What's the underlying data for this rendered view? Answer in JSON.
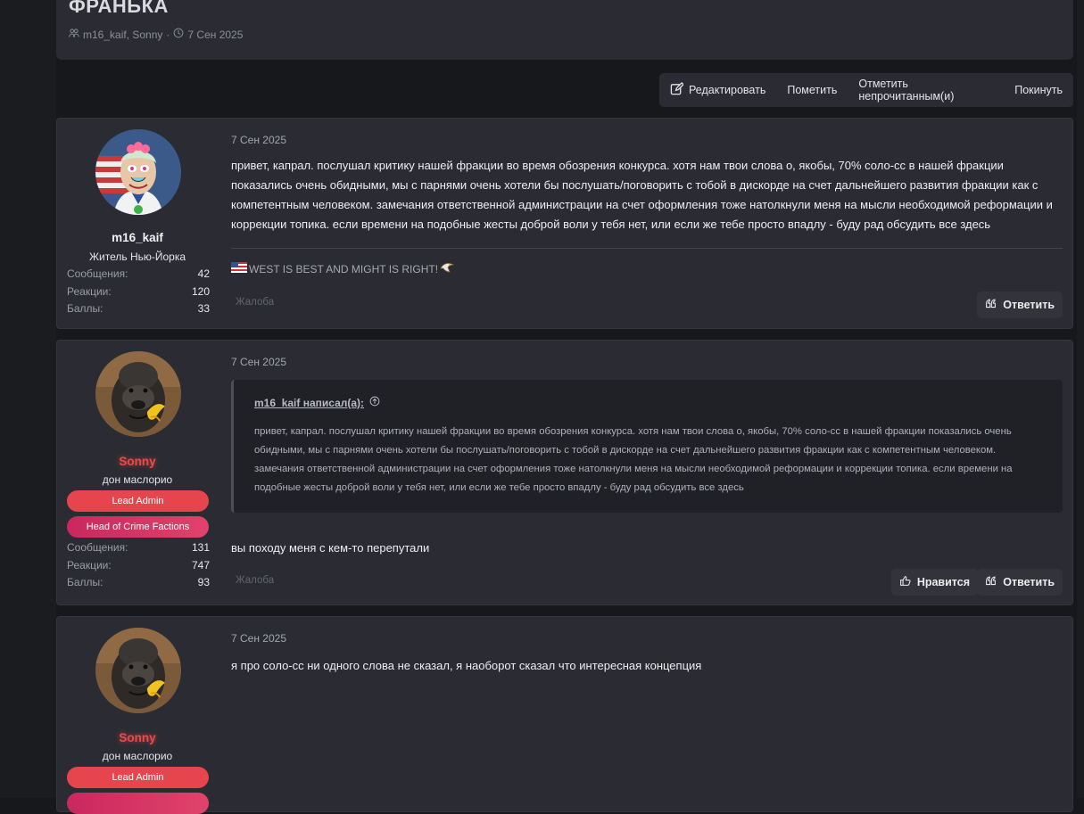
{
  "thread": {
    "title": "ФРАНЬКА",
    "participants": "m16_kaif, Sonny",
    "separator": "·",
    "date": "7 Сен 2025"
  },
  "actions": {
    "edit": "Редактировать",
    "mark": "Пометить",
    "mark_unread": "Отметить непрочитанным(и)",
    "leave": "Покинуть"
  },
  "labels": {
    "messages": "Сообщения:",
    "reactions": "Реакции:",
    "points": "Баллы:",
    "report": "Жалоба",
    "reply": "Ответить",
    "like": "Нравится"
  },
  "posts": [
    {
      "date": "7 Сен 2025",
      "author": {
        "name": "m16_kaif",
        "title": "Житель Нью-Йорка",
        "messages": "42",
        "reactions": "120",
        "points": "33"
      },
      "text": "привет, капрал. послушал критику нашей фракции во время обозрения конкурса. хотя нам твои слова о, якобы, 70% соло-сс в нашей фракции показались очень обидными, мы с парнями очень хотели бы послушать/поговорить с тобой в дискорде на счет дальнейшего развития фракции как с компетентным человеком. замечания ответственной администрации на счет оформления тоже натолкнули меня на мысли необходимой реформации и коррекции топика. если времени на подобные жесты доброй воли у тебя нет, или если же тебе просто впадлу - буду рад обсудить все здесь",
      "signature": "WEST IS BEST AND MIGHT IS RIGHT!"
    },
    {
      "date": "7 Сен 2025",
      "author": {
        "name": "Sonny",
        "title": "дон маслорио",
        "badges": [
          "Lead Admin",
          "Head of Crime Factions"
        ],
        "messages": "131",
        "reactions": "747",
        "points": "93"
      },
      "quote": {
        "author": "m16_kaif написал(а):",
        "text": "привет, капрал. послушал критику нашей фракции во время обозрения конкурса. хотя нам твои слова о, якобы, 70% соло-сс в нашей фракции показались очень обидными, мы с парнями очень хотели бы послушать/поговорить с тобой в дискорде на счет дальнейшего развития фракции как с компетентным человеком. замечания ответственной администрации на счет оформления тоже натолкнули меня на мысли необходимой реформации и коррекции топика. если времени на подобные жесты доброй воли у тебя нет, или если же тебе просто впадлу - буду рад обсудить все здесь"
      },
      "text": "вы походу меня с кем-то перепутали"
    },
    {
      "date": "7 Сен 2025",
      "author": {
        "name": "Sonny",
        "title": "дон маслорио",
        "badges": [
          "Lead Admin"
        ]
      },
      "text": "я про соло-сс ни одного слова не сказал, я наоборот сказал что интересная концепция"
    }
  ],
  "colors": {
    "background": "#17181c",
    "panel": "#2b2c33",
    "accent_red": "#e7454d",
    "accent_pink": "#c9285f"
  }
}
